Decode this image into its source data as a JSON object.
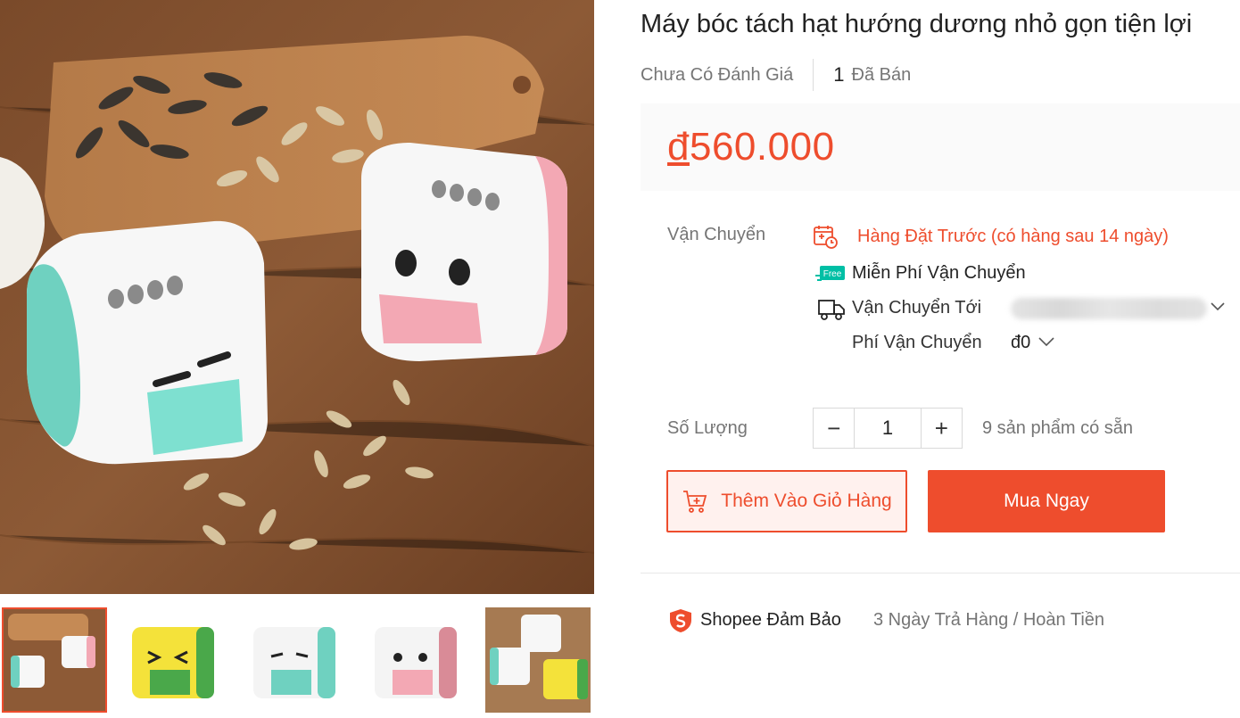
{
  "product": {
    "title": "Máy bóc tách hạt hướng dương nhỏ gọn tiện lợi",
    "rating_text": "Chưa Có Đánh Giá",
    "sold_count": "1",
    "sold_label": "Đã Bán",
    "price_currency": "đ",
    "price_value": "560.000"
  },
  "shipping": {
    "label": "Vận Chuyển",
    "preorder_icon": "calendar-clock-icon",
    "preorder_text": "Hàng Đặt Trước (có hàng sau 14 ngày)",
    "free_badge": "Free",
    "free_text": "Miễn Phí Vận Chuyển",
    "ship_to_label": "Vận Chuyển Tới",
    "fee_label": "Phí Vận Chuyển",
    "fee_value": "đ0"
  },
  "quantity": {
    "label": "Số Lượng",
    "decrement": "−",
    "value": "1",
    "increment": "+",
    "stock_text": "9 sản phẩm có sẵn"
  },
  "actions": {
    "add_to_cart": "Thêm Vào Giỏ Hàng",
    "buy_now": "Mua Ngay"
  },
  "guarantee": {
    "label": "Shopee Đảm Bảo",
    "text": "3 Ngày Trả Hàng / Hoàn Tiền"
  },
  "colors": {
    "accent": "#ee4d2d",
    "price_bg": "#fafafa",
    "teal": "#6fd1c0",
    "pink": "#f4a9b3"
  }
}
